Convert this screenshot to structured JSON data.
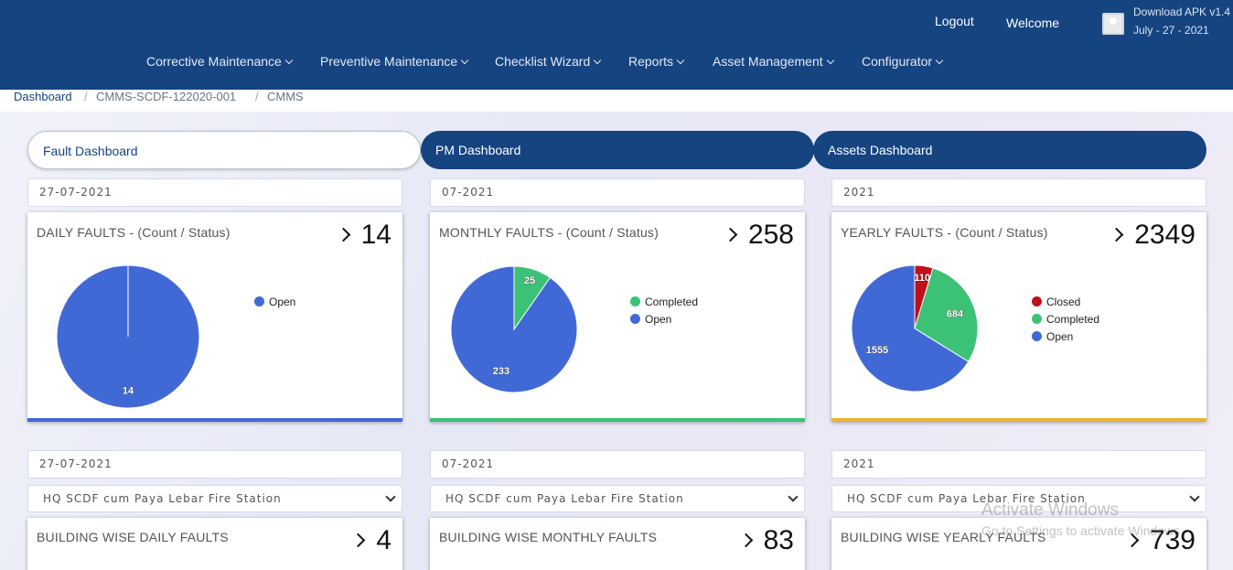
{
  "header": {
    "logout": "Logout",
    "welcome": "Welcome",
    "apk_line1": "Download APK v1.4",
    "apk_line2": "July - 27 - 2021",
    "nav": [
      {
        "label": "Corrective Maintenance"
      },
      {
        "label": "Preventive Maintenance"
      },
      {
        "label": "Checklist Wizard"
      },
      {
        "label": "Reports"
      },
      {
        "label": "Asset Management"
      },
      {
        "label": "Configurator"
      }
    ]
  },
  "breadcrumb": {
    "items": [
      "Dashboard",
      "CMMS-SCDF-122020-001",
      "CMMS"
    ],
    "separator": "/"
  },
  "tabs": [
    {
      "label": "Fault Dashboard",
      "active": true
    },
    {
      "label": "PM Dashboard",
      "active": false
    },
    {
      "label": "Assets Dashboard",
      "active": false
    }
  ],
  "colors": {
    "primary": "#154481",
    "open": "#4169d6",
    "completed": "#3cc276",
    "closed": "#c0111a",
    "bar_daily": "#4169d6",
    "bar_monthly": "#3cc276",
    "bar_yearly": "#e9b431"
  },
  "cards": [
    {
      "date": "27-07-2021",
      "title": "DAILY FAULTS - (Count / Status)",
      "count": "14",
      "bar_color": "#4169d6",
      "chart_data": {
        "type": "pie",
        "title": "DAILY FAULTS - (Count / Status)",
        "slices": [
          {
            "label": "Open",
            "value": 14,
            "color": "#4169d6"
          }
        ],
        "legend_position": "right"
      }
    },
    {
      "date": "07-2021",
      "title": "MONTHLY FAULTS - (Count / Status)",
      "count": "258",
      "bar_color": "#3cc276",
      "chart_data": {
        "type": "pie",
        "title": "MONTHLY FAULTS - (Count / Status)",
        "slices": [
          {
            "label": "Completed",
            "value": 25,
            "color": "#3cc276"
          },
          {
            "label": "Open",
            "value": 233,
            "color": "#4169d6"
          }
        ],
        "legend_position": "right"
      }
    },
    {
      "date": "2021",
      "title": "YEARLY FAULTS - (Count / Status)",
      "count": "2349",
      "bar_color": "#e9b431",
      "chart_data": {
        "type": "pie",
        "title": "YEARLY FAULTS - (Count / Status)",
        "slices": [
          {
            "label": "Closed",
            "value": 110,
            "color": "#c0111a"
          },
          {
            "label": "Completed",
            "value": 684,
            "color": "#3cc276"
          },
          {
            "label": "Open",
            "value": 1555,
            "color": "#4169d6"
          }
        ],
        "legend_position": "right"
      }
    }
  ],
  "building_cards": [
    {
      "date": "27-07-2021",
      "building": "HQ SCDF cum Paya Lebar Fire Station",
      "title": "BUILDING WISE DAILY FAULTS",
      "count": "4"
    },
    {
      "date": "07-2021",
      "building": "HQ SCDF cum Paya Lebar Fire Station",
      "title": "BUILDING WISE MONTHLY FAULTS",
      "count": "83"
    },
    {
      "date": "2021",
      "building": "HQ SCDF cum Paya Lebar Fire Station",
      "title": "BUILDING WISE YEARLY FAULTS",
      "count": "739"
    }
  ],
  "watermark": {
    "line1": "Activate Windows",
    "line2": "Go to Settings to activate Windows."
  }
}
